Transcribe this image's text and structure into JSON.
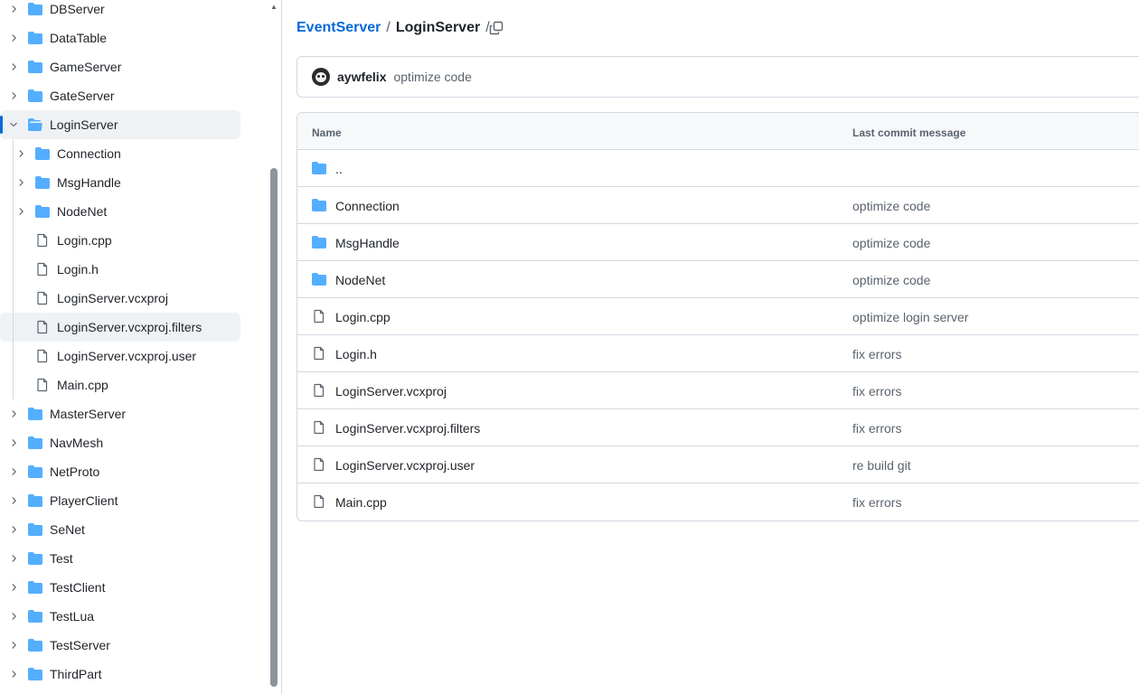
{
  "sidebar": {
    "items": [
      {
        "label": "DBServer",
        "type": "dir",
        "level": 0,
        "expanded": false
      },
      {
        "label": "DataTable",
        "type": "dir",
        "level": 0,
        "expanded": false
      },
      {
        "label": "GameServer",
        "type": "dir",
        "level": 0,
        "expanded": false
      },
      {
        "label": "GateServer",
        "type": "dir",
        "level": 0,
        "expanded": false
      },
      {
        "label": "LoginServer",
        "type": "dir",
        "level": 0,
        "expanded": true,
        "active": true
      },
      {
        "label": "Connection",
        "type": "dir",
        "level": 1,
        "expanded": false
      },
      {
        "label": "MsgHandle",
        "type": "dir",
        "level": 1,
        "expanded": false
      },
      {
        "label": "NodeNet",
        "type": "dir",
        "level": 1,
        "expanded": false
      },
      {
        "label": "Login.cpp",
        "type": "file",
        "level": 1
      },
      {
        "label": "Login.h",
        "type": "file",
        "level": 1
      },
      {
        "label": "LoginServer.vcxproj",
        "type": "file",
        "level": 1
      },
      {
        "label": "LoginServer.vcxproj.filters",
        "type": "file",
        "level": 1,
        "hover": true
      },
      {
        "label": "LoginServer.vcxproj.user",
        "type": "file",
        "level": 1
      },
      {
        "label": "Main.cpp",
        "type": "file",
        "level": 1
      },
      {
        "label": "MasterServer",
        "type": "dir",
        "level": 0,
        "expanded": false
      },
      {
        "label": "NavMesh",
        "type": "dir",
        "level": 0,
        "expanded": false
      },
      {
        "label": "NetProto",
        "type": "dir",
        "level": 0,
        "expanded": false
      },
      {
        "label": "PlayerClient",
        "type": "dir",
        "level": 0,
        "expanded": false
      },
      {
        "label": "SeNet",
        "type": "dir",
        "level": 0,
        "expanded": false
      },
      {
        "label": "Test",
        "type": "dir",
        "level": 0,
        "expanded": false
      },
      {
        "label": "TestClient",
        "type": "dir",
        "level": 0,
        "expanded": false
      },
      {
        "label": "TestLua",
        "type": "dir",
        "level": 0,
        "expanded": false
      },
      {
        "label": "TestServer",
        "type": "dir",
        "level": 0,
        "expanded": false
      },
      {
        "label": "ThirdPart",
        "type": "dir",
        "level": 0,
        "expanded": false
      }
    ]
  },
  "breadcrumb": {
    "root": "EventServer",
    "separator": "/",
    "current": "LoginServer"
  },
  "commit": {
    "author": "aywfelix",
    "message": "optimize code"
  },
  "table": {
    "headers": {
      "name": "Name",
      "message": "Last commit message"
    },
    "rows": [
      {
        "name": "..",
        "type": "parent",
        "message": ""
      },
      {
        "name": "Connection",
        "type": "dir",
        "message": "optimize code"
      },
      {
        "name": "MsgHandle",
        "type": "dir",
        "message": "optimize code"
      },
      {
        "name": "NodeNet",
        "type": "dir",
        "message": "optimize code"
      },
      {
        "name": "Login.cpp",
        "type": "file",
        "message": "optimize login server"
      },
      {
        "name": "Login.h",
        "type": "file",
        "message": "fix errors"
      },
      {
        "name": "LoginServer.vcxproj",
        "type": "file",
        "message": "fix errors"
      },
      {
        "name": "LoginServer.vcxproj.filters",
        "type": "file",
        "message": "fix errors"
      },
      {
        "name": "LoginServer.vcxproj.user",
        "type": "file",
        "message": "re build git"
      },
      {
        "name": "Main.cpp",
        "type": "file",
        "message": "fix errors"
      }
    ]
  },
  "colors": {
    "folder": "#54aeff",
    "link": "#0969da",
    "muted": "#59636e",
    "border": "#d1d9e0",
    "active": "#0969da"
  },
  "icons": {
    "folder": "folder-icon",
    "folder_open": "folder-open-icon",
    "file": "file-icon",
    "chevron_right": "chevron-right-icon",
    "chevron_down": "chevron-down-icon",
    "copy": "copy-icon"
  }
}
